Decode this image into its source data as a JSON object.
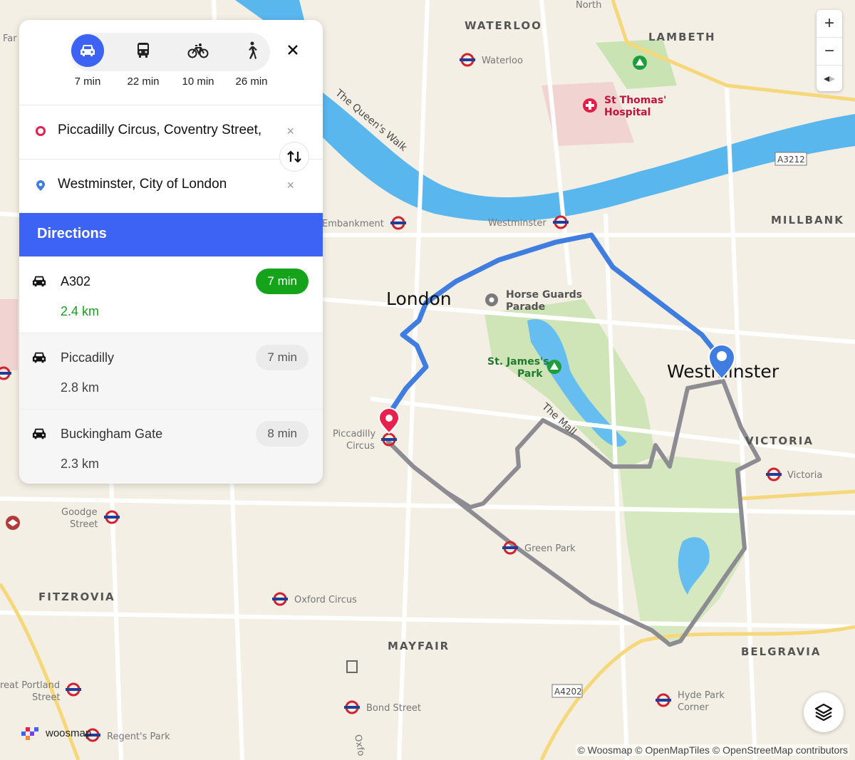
{
  "panel": {
    "modes": [
      {
        "icon": "car-icon",
        "label": "7 min",
        "active": true
      },
      {
        "icon": "bus-icon",
        "label": "22 min",
        "active": false
      },
      {
        "icon": "bicycle-icon",
        "label": "10 min",
        "active": false
      },
      {
        "icon": "walk-icon",
        "label": "26 min",
        "active": false
      }
    ],
    "origin": {
      "value": "Piccadilly Circus, Coventry Street,",
      "clear": "×"
    },
    "destination": {
      "value": "Westminster, City of London",
      "clear": "×"
    },
    "directions_title": "Directions",
    "routes": [
      {
        "name": "A302",
        "distance": "2.4 km",
        "duration": "7 min",
        "selected": true
      },
      {
        "name": "Piccadilly",
        "distance": "2.8 km",
        "duration": "7 min",
        "selected": false
      },
      {
        "name": "Buckingham Gate",
        "distance": "2.3 km",
        "duration": "8 min",
        "selected": false
      }
    ]
  },
  "map": {
    "zoom_in": "+",
    "zoom_out": "−",
    "attribution": "© Woosmap © OpenMapTiles © OpenStreetMap contributors",
    "logo_text": "woosmap",
    "place_labels": {
      "waterloo_area": "WATERLOO",
      "lambeth": "LAMBETH",
      "waterloo_station": "Waterloo",
      "st_thomas_1": "St Thomas'",
      "st_thomas_2": "Hospital",
      "queens_walk": "The Queen's Walk",
      "a3212": "A3212",
      "millbank": "MILLBANK",
      "embankment": "Embankment",
      "westminster_station": "Westminster",
      "london": "London",
      "horse_guards_1": "Horse Guards",
      "horse_guards_2": "Parade",
      "st_james_1": "St. James's",
      "st_james_2": "Park",
      "westminster": "Westminster",
      "piccadilly_circus_1": "Piccadilly",
      "piccadilly_circus_2": "Circus",
      "the_mall": "The Mall",
      "victoria_area": "VICTORIA",
      "victoria_station": "Victoria",
      "goodge_1": "Goodge",
      "goodge_2": "Street",
      "green_park": "Green Park",
      "fitzrovia": "FITZROVIA",
      "oxford_circus": "Oxford Circus",
      "mayfair": "MAYFAIR",
      "belgravia": "BELGRAVIA",
      "a4202": "A4202",
      "great_portland_1": "reat Portland",
      "great_portland_2": "Street",
      "hyde_park_1": "Hyde Park",
      "hyde_park_2": "Corner",
      "bond_street": "Bond Street",
      "regents_park": "Regent's Park",
      "north": "North",
      "far": "Far",
      "oxford": "Oxfo"
    }
  },
  "colors": {
    "accent": "#3d63f4",
    "selected_green": "#15a31b",
    "route_blue": "#3f7de0",
    "route_alt": "#9a9aa0",
    "origin_pin": "#e8204e"
  }
}
